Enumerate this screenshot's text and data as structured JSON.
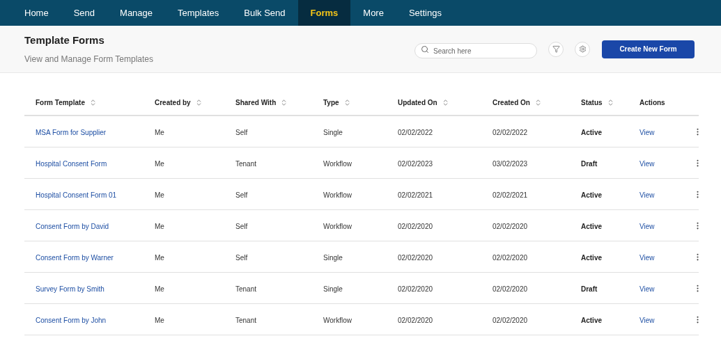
{
  "nav": {
    "tabs": [
      {
        "label": "Home",
        "selected": false
      },
      {
        "label": "Send",
        "selected": false
      },
      {
        "label": "Manage",
        "selected": false
      },
      {
        "label": "Templates",
        "selected": false
      },
      {
        "label": "Bulk Send",
        "selected": false
      },
      {
        "label": "Forms",
        "selected": true
      },
      {
        "label": "More",
        "selected": false
      },
      {
        "label": "Settings",
        "selected": false
      }
    ]
  },
  "header": {
    "title": "Template Forms",
    "subtitle": "View and Manage Form Templates",
    "search": {
      "placeholder": "Search here"
    },
    "create_button": "Create New Form"
  },
  "table": {
    "columns": [
      {
        "label": "Form Template",
        "sortable": true
      },
      {
        "label": "Created by",
        "sortable": true
      },
      {
        "label": "Shared With",
        "sortable": true
      },
      {
        "label": "Type",
        "sortable": true
      },
      {
        "label": "Updated On",
        "sortable": true
      },
      {
        "label": "Created On",
        "sortable": true
      },
      {
        "label": "Status",
        "sortable": true
      },
      {
        "label": "Actions",
        "sortable": false
      }
    ],
    "rows": [
      {
        "cells": [
          "MSA Form for Supplier",
          "Me",
          "Self",
          "Single",
          "02/02/2022",
          "02/02/2022",
          "Active"
        ],
        "action": "View"
      },
      {
        "cells": [
          "Hospital Consent Form",
          "Me",
          "Tenant",
          "Workflow",
          "02/02/2023",
          "03/02/2023",
          "Draft"
        ],
        "action": "View"
      },
      {
        "cells": [
          "Hospital Consent Form 01",
          "Me",
          "Self",
          "Workflow",
          "02/02/2021",
          "02/02/2021",
          "Active"
        ],
        "action": "View"
      },
      {
        "cells": [
          "Consent Form by David",
          "Me",
          "Self",
          "Workflow",
          "02/02/2020",
          "02/02/2020",
          "Active"
        ],
        "action": "View"
      },
      {
        "cells": [
          "Consent Form by Warner",
          "Me",
          "Self",
          "Single",
          "02/02/2020",
          "02/02/2020",
          "Active"
        ],
        "action": "View"
      },
      {
        "cells": [
          "Survey Form by Smith",
          "Me",
          "Tenant",
          "Single",
          "02/02/2020",
          "02/02/2020",
          "Draft"
        ],
        "action": "View"
      },
      {
        "cells": [
          "Consent Form by John",
          "Me",
          "Tenant",
          "Workflow",
          "02/02/2020",
          "02/02/2020",
          "Active"
        ],
        "action": "View"
      }
    ]
  }
}
